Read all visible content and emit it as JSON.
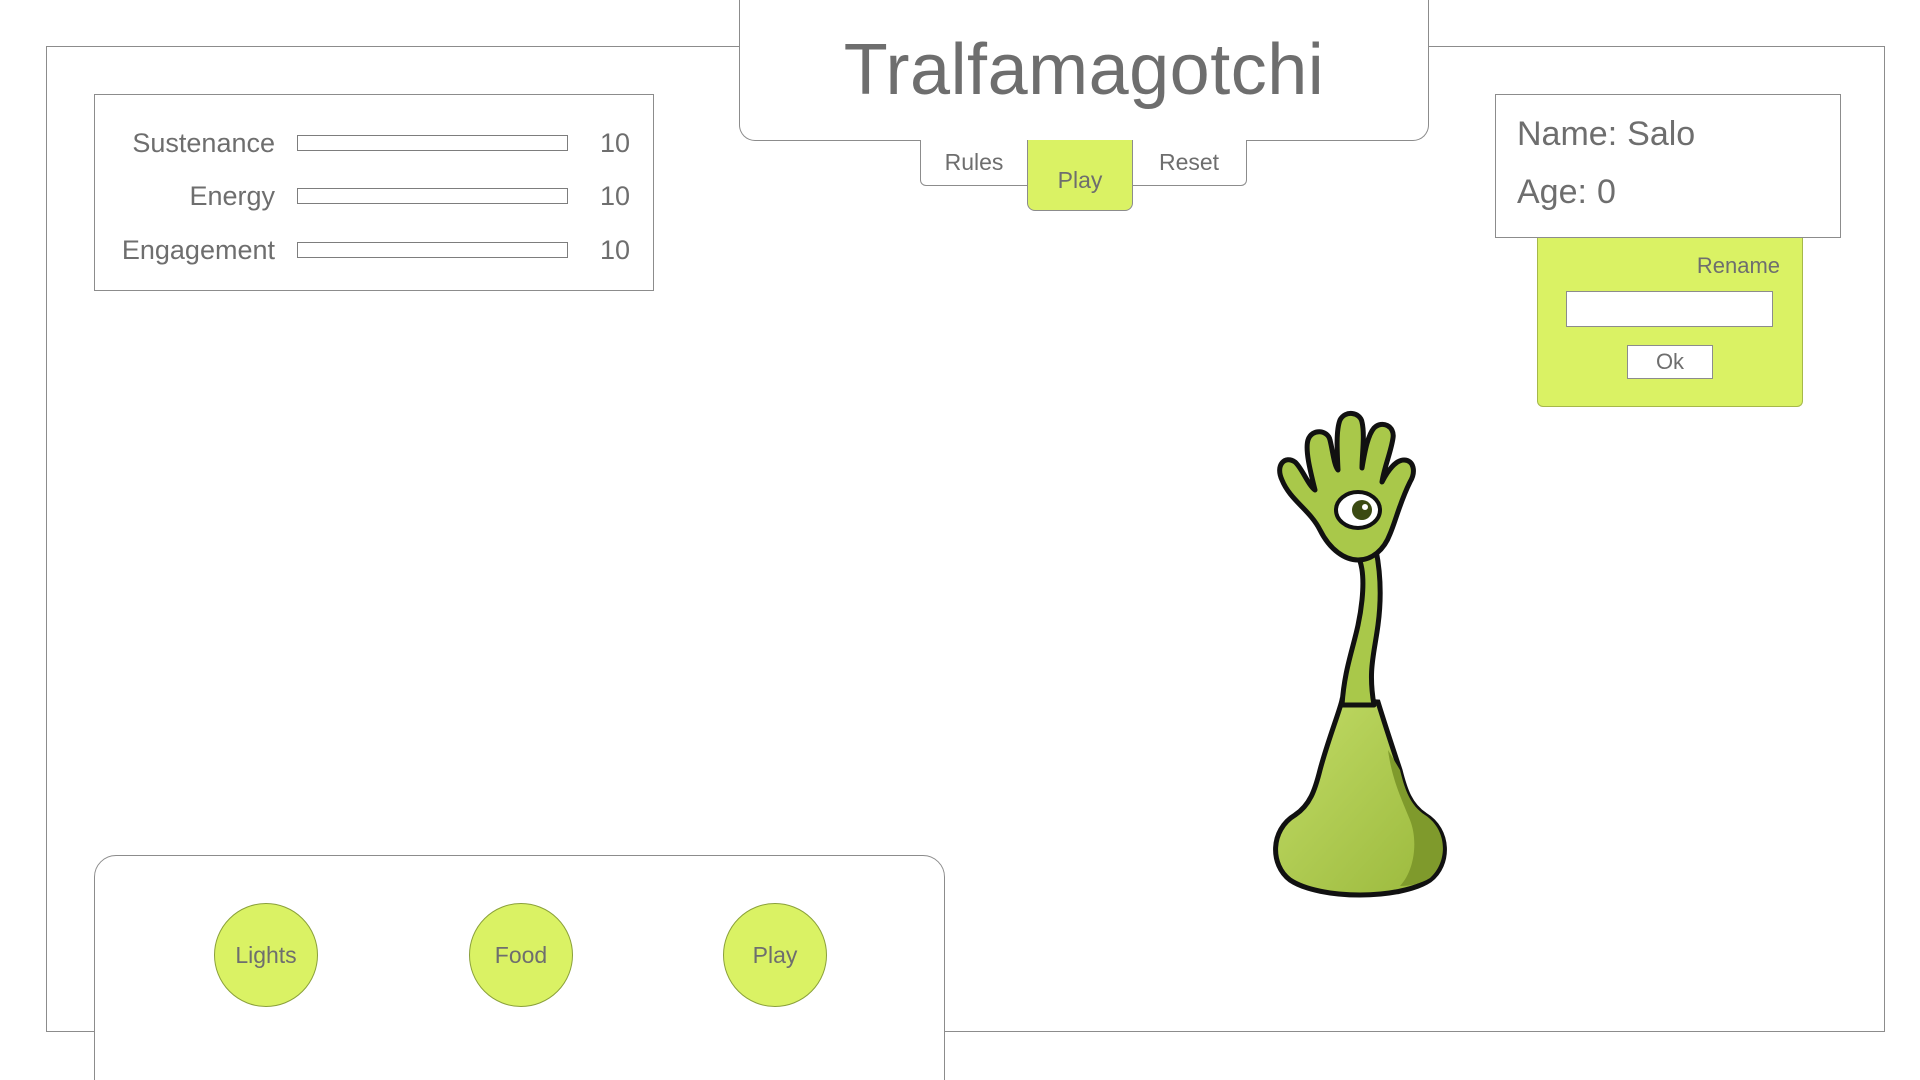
{
  "app": {
    "title": "Tralfamagotchi"
  },
  "tabs": [
    {
      "label": "Rules",
      "active": false
    },
    {
      "label": "Play",
      "active": true
    },
    {
      "label": "Reset",
      "active": false
    }
  ],
  "stats": [
    {
      "label": "Sustenance",
      "value": "10",
      "level": 0
    },
    {
      "label": "Energy",
      "value": "10",
      "level": 0
    },
    {
      "label": "Engagement",
      "value": "10",
      "level": 0
    }
  ],
  "pet": {
    "name_label": "Name:",
    "name": "Salo",
    "age_label": "Age:",
    "age": "0",
    "icon": "hand-with-eye-creature-icon"
  },
  "rename": {
    "label": "Rename",
    "input_value": "",
    "ok_label": "Ok"
  },
  "actions": [
    {
      "label": "Lights"
    },
    {
      "label": "Food"
    },
    {
      "label": "Play"
    }
  ],
  "colors": {
    "accent": "#daf264",
    "text": "#6e6e6e",
    "border": "#8c8c8c",
    "creature_fill": "#a9c84a",
    "creature_shadow": "#7f9a2c"
  }
}
